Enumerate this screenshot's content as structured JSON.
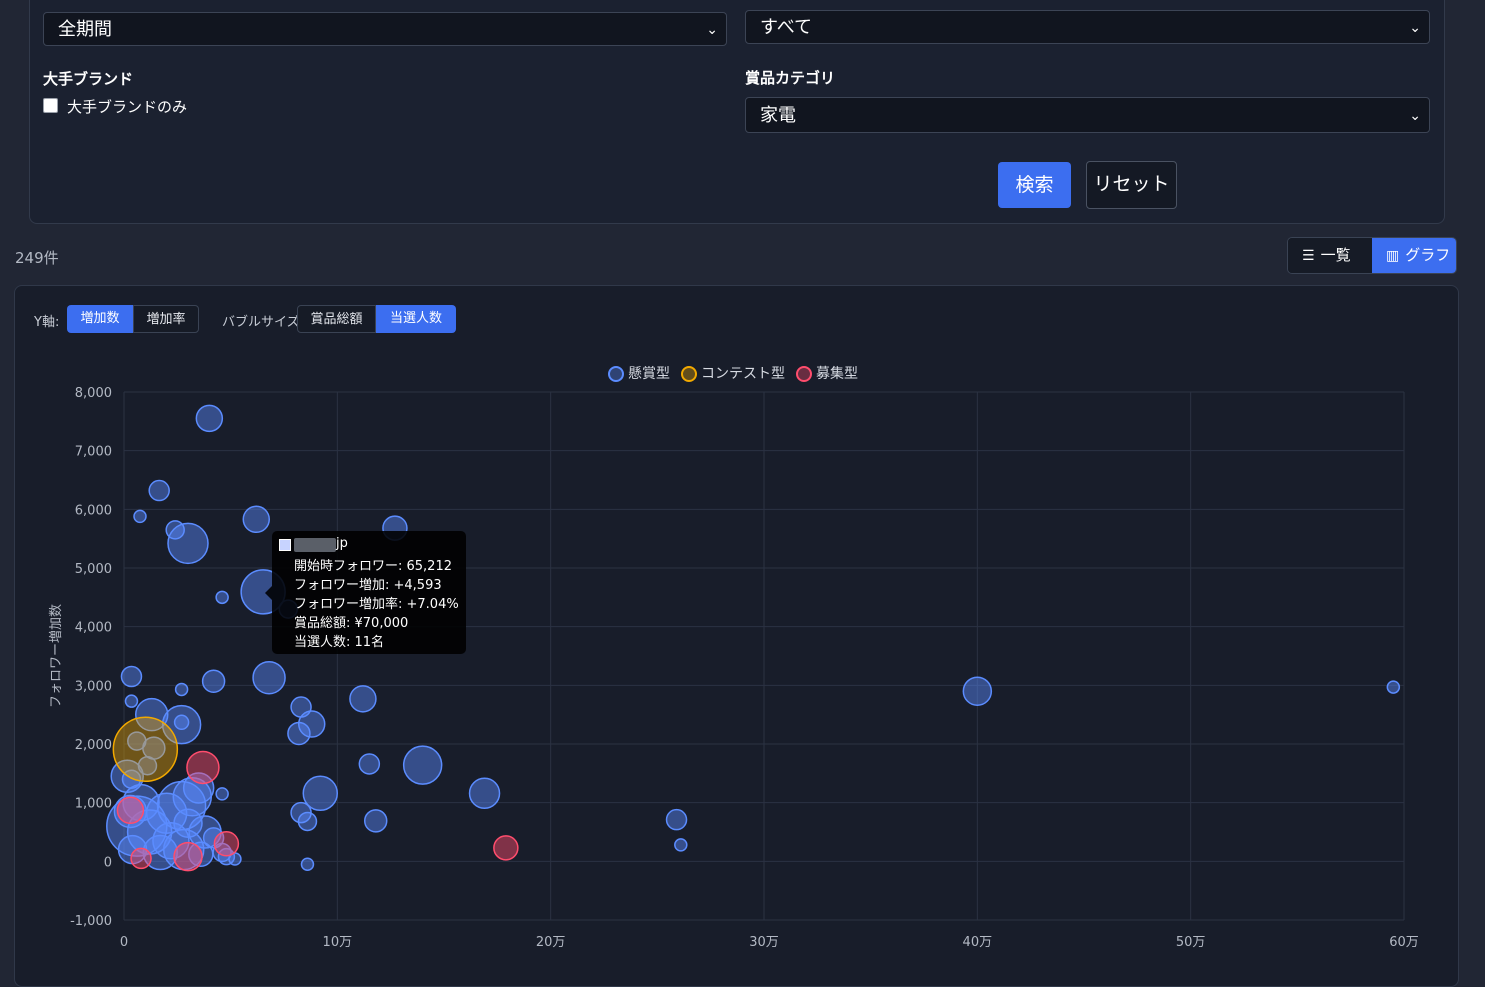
{
  "filters": {
    "period_value": "全期間",
    "type_value": "すべて",
    "brand_heading": "大手ブランド",
    "brand_checkbox_label": "大手ブランドのみ",
    "category_heading": "賞品カテゴリ",
    "category_value": "家電",
    "search_label": "検索",
    "reset_label": "リセット"
  },
  "results": {
    "count_text": "249件"
  },
  "view_toggle": {
    "list_label": "一覧",
    "graph_label": "グラフ",
    "active": "graph"
  },
  "chart_controls": {
    "y_axis_label": "Y軸:",
    "y_options": [
      "増加数",
      "増加率"
    ],
    "y_selected": "増加数",
    "bubble_label": "バブルサイズ:",
    "bubble_options": [
      "賞品総額",
      "当選人数"
    ],
    "bubble_selected": "当選人数"
  },
  "chart_data": {
    "type": "scatter",
    "ylabel": "フォロワー増加数",
    "xlim": [
      0,
      600000
    ],
    "ylim": [
      -1000,
      8000
    ],
    "x_ticks": [
      "0",
      "10万",
      "20万",
      "30万",
      "40万",
      "50万",
      "60万"
    ],
    "y_ticks": [
      "-1,000",
      "0",
      "1,000",
      "2,000",
      "3,000",
      "4,000",
      "5,000",
      "6,000",
      "7,000",
      "8,000"
    ],
    "grid": true,
    "legend_position": "top",
    "colors": {
      "懸賞型": "#5b8cff",
      "コンテスト型": "#f2a900",
      "募集型": "#ff4d6d"
    },
    "series": [
      {
        "name": "懸賞型",
        "points": [
          {
            "x": 40000,
            "y": 7550,
            "r": 13
          },
          {
            "x": 16500,
            "y": 6320,
            "r": 10
          },
          {
            "x": 7500,
            "y": 5880,
            "r": 6
          },
          {
            "x": 24000,
            "y": 5650,
            "r": 9
          },
          {
            "x": 30000,
            "y": 5420,
            "r": 20
          },
          {
            "x": 62000,
            "y": 5830,
            "r": 13
          },
          {
            "x": 127000,
            "y": 5680,
            "r": 12
          },
          {
            "x": 65212,
            "y": 4593,
            "r": 22
          },
          {
            "x": 46000,
            "y": 4500,
            "r": 6
          },
          {
            "x": 77000,
            "y": 4300,
            "r": 9
          },
          {
            "x": 3500,
            "y": 3150,
            "r": 10
          },
          {
            "x": 27000,
            "y": 2930,
            "r": 6
          },
          {
            "x": 42000,
            "y": 3070,
            "r": 11
          },
          {
            "x": 68000,
            "y": 3130,
            "r": 16
          },
          {
            "x": 3500,
            "y": 2730,
            "r": 6
          },
          {
            "x": 13000,
            "y": 2500,
            "r": 16
          },
          {
            "x": 27000,
            "y": 2330,
            "r": 19
          },
          {
            "x": 27000,
            "y": 2370,
            "r": 7
          },
          {
            "x": 83000,
            "y": 2630,
            "r": 10
          },
          {
            "x": 88000,
            "y": 2340,
            "r": 13
          },
          {
            "x": 82000,
            "y": 2180,
            "r": 11
          },
          {
            "x": 112000,
            "y": 2770,
            "r": 13
          },
          {
            "x": 6000,
            "y": 2050,
            "r": 9
          },
          {
            "x": 14000,
            "y": 1930,
            "r": 11
          },
          {
            "x": 11000,
            "y": 1630,
            "r": 9
          },
          {
            "x": 1500,
            "y": 1450,
            "r": 16
          },
          {
            "x": 3500,
            "y": 1400,
            "r": 9
          },
          {
            "x": 115000,
            "y": 1660,
            "r": 10
          },
          {
            "x": 140000,
            "y": 1640,
            "r": 19
          },
          {
            "x": 92000,
            "y": 1160,
            "r": 17
          },
          {
            "x": 169000,
            "y": 1160,
            "r": 15
          },
          {
            "x": 46000,
            "y": 1150,
            "r": 6
          },
          {
            "x": 35000,
            "y": 1250,
            "r": 15
          },
          {
            "x": 32000,
            "y": 1100,
            "r": 19
          },
          {
            "x": 27000,
            "y": 950,
            "r": 24
          },
          {
            "x": 20000,
            "y": 820,
            "r": 20
          },
          {
            "x": 8000,
            "y": 1000,
            "r": 18
          },
          {
            "x": 3000,
            "y": 850,
            "r": 16
          },
          {
            "x": 6000,
            "y": 600,
            "r": 30
          },
          {
            "x": 12000,
            "y": 500,
            "r": 22
          },
          {
            "x": 30000,
            "y": 650,
            "r": 14
          },
          {
            "x": 38000,
            "y": 500,
            "r": 16
          },
          {
            "x": 22000,
            "y": 350,
            "r": 18
          },
          {
            "x": 42000,
            "y": 400,
            "r": 10
          },
          {
            "x": 17000,
            "y": 150,
            "r": 17
          },
          {
            "x": 28000,
            "y": 200,
            "r": 20
          },
          {
            "x": 36000,
            "y": 120,
            "r": 12
          },
          {
            "x": 4000,
            "y": 200,
            "r": 14
          },
          {
            "x": 46000,
            "y": 150,
            "r": 9
          },
          {
            "x": 48000,
            "y": 80,
            "r": 8
          },
          {
            "x": 52000,
            "y": 40,
            "r": 6
          },
          {
            "x": 83000,
            "y": 830,
            "r": 10
          },
          {
            "x": 86000,
            "y": 680,
            "r": 9
          },
          {
            "x": 118000,
            "y": 690,
            "r": 11
          },
          {
            "x": 86000,
            "y": -50,
            "r": 6
          },
          {
            "x": 259000,
            "y": 710,
            "r": 10
          },
          {
            "x": 261000,
            "y": 280,
            "r": 6
          },
          {
            "x": 400000,
            "y": 2900,
            "r": 14
          },
          {
            "x": 595000,
            "y": 2970,
            "r": 6
          }
        ]
      },
      {
        "name": "コンテスト型",
        "points": [
          {
            "x": 10000,
            "y": 1910,
            "r": 32
          }
        ]
      },
      {
        "name": "募集型",
        "points": [
          {
            "x": 37000,
            "y": 1600,
            "r": 16
          },
          {
            "x": 3000,
            "y": 870,
            "r": 13
          },
          {
            "x": 48000,
            "y": 300,
            "r": 12
          },
          {
            "x": 179000,
            "y": 230,
            "r": 12
          },
          {
            "x": 30000,
            "y": 80,
            "r": 14
          },
          {
            "x": 8000,
            "y": 50,
            "r": 10
          }
        ]
      }
    ],
    "tooltip": {
      "name_suffix": "jp",
      "lines": [
        "開始時フォロワー: 65,212",
        "フォロワー増加: +4,593",
        "フォロワー増加率: +7.04%",
        "賞品総額: ¥70,000",
        "当選人数: 11名"
      ]
    }
  }
}
